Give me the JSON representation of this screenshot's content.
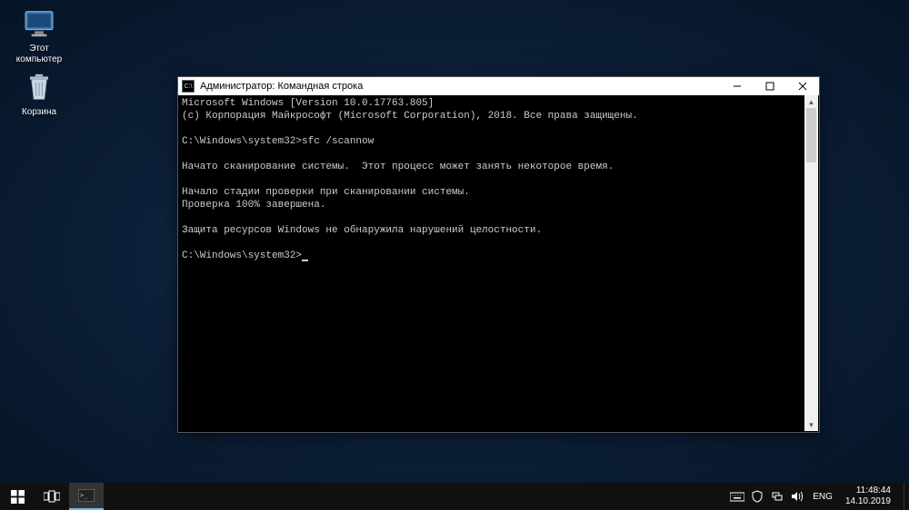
{
  "desktop": {
    "icons": [
      {
        "name": "computer",
        "label": "Этот\nкомпьютер"
      },
      {
        "name": "recycle",
        "label": "Корзина"
      }
    ]
  },
  "cmd": {
    "title": "Администратор: Командная строка",
    "icon_abbrev": "C:\\",
    "lines": {
      "l0": "Microsoft Windows [Version 10.0.17763.805]",
      "l1": "(c) Корпорация Майкрософт (Microsoft Corporation), 2018. Все права защищены.",
      "l2": "",
      "l3": "C:\\Windows\\system32>sfc /scannow",
      "l4": "",
      "l5": "Начато сканирование системы.  Этот процесс может занять некоторое время.",
      "l6": "",
      "l7": "Начало стадии проверки при сканировании системы.",
      "l8": "Проверка 100% завершена.",
      "l9": "",
      "l10": "Защита ресурсов Windows не обнаружила нарушений целостности.",
      "l11": "",
      "l12": "C:\\Windows\\system32>"
    }
  },
  "taskbar": {
    "tray": {
      "language": "ENG",
      "time": "11:48:44",
      "date": "14.10.2019"
    }
  }
}
